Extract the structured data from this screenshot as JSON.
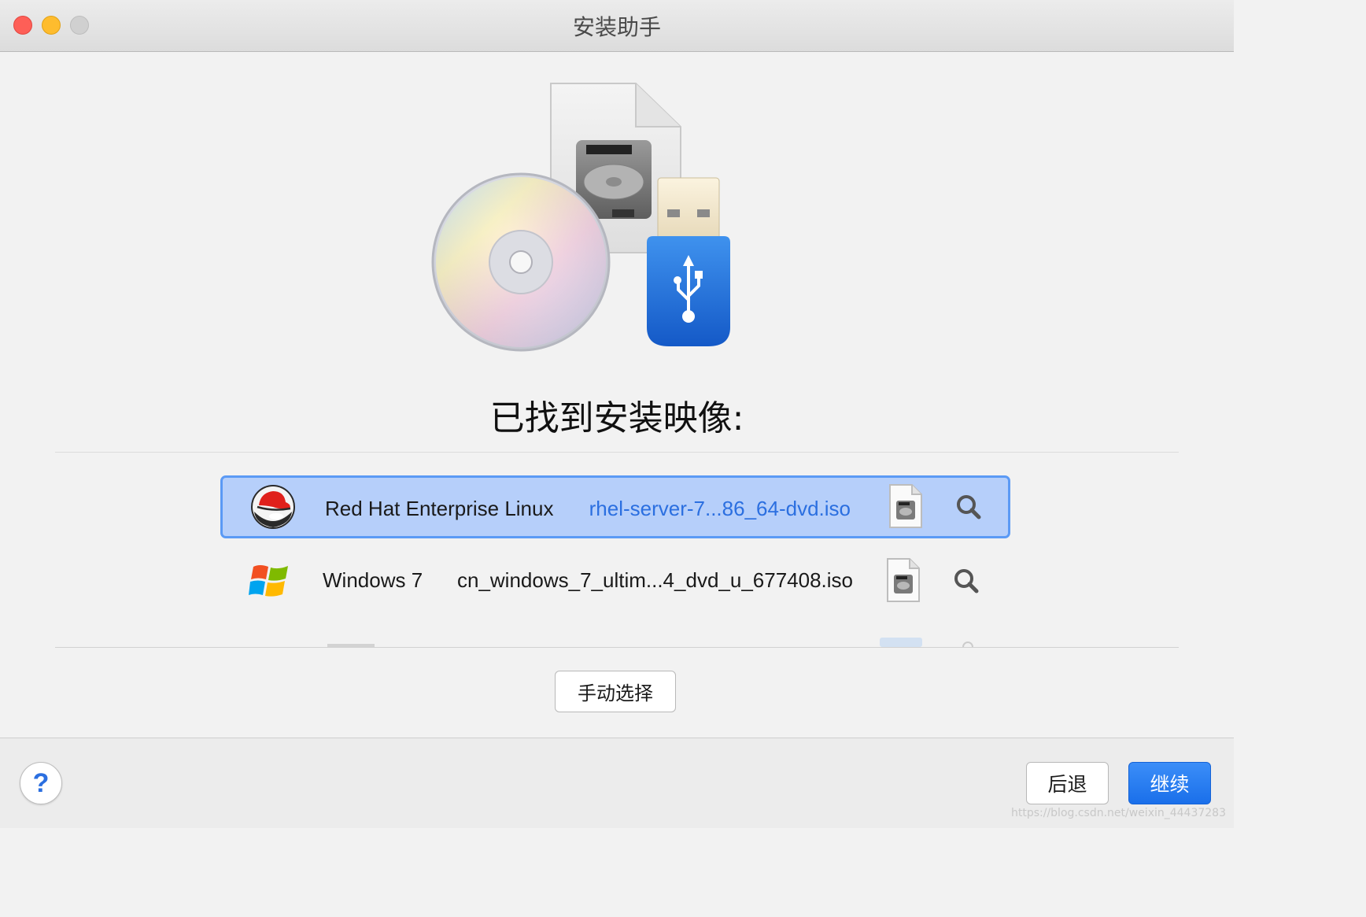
{
  "window": {
    "title": "安装助手"
  },
  "main": {
    "heading": "已找到安装映像:",
    "images": [
      {
        "os_name": "Red Hat Enterprise Linux",
        "file_name": "rhel-server-7...86_64-dvd.iso",
        "os_icon": "redhat-logo-icon",
        "selected": true
      },
      {
        "os_name": "Windows 7",
        "file_name": "cn_windows_7_ultim...4_dvd_u_677408.iso",
        "os_icon": "windows-logo-icon",
        "selected": false
      }
    ],
    "manual_select_label": "手动选择"
  },
  "footer": {
    "help_label": "?",
    "back_label": "后退",
    "continue_label": "继续"
  },
  "watermark": "https://blog.csdn.net/weixin_44437283",
  "colors": {
    "accent": "#1a6fea",
    "selection_bg": "#b6cffa",
    "selection_border": "#5b9af5"
  }
}
